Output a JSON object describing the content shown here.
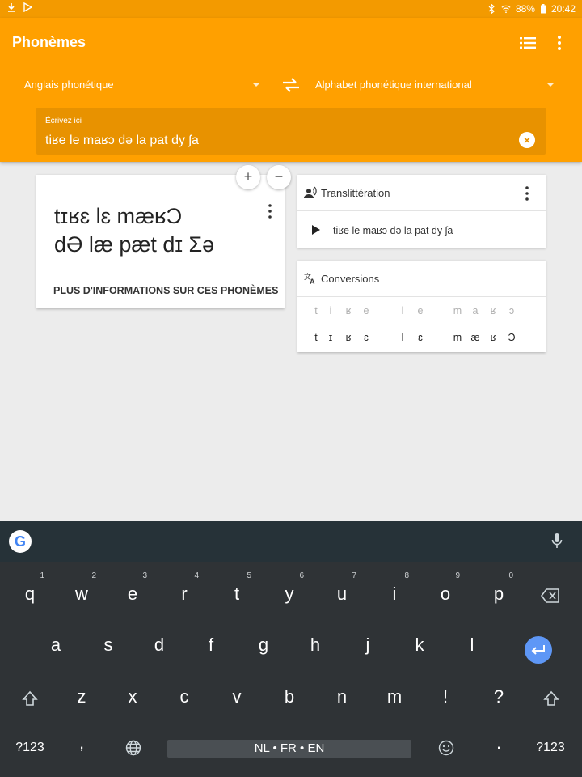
{
  "status": {
    "battery": "88%",
    "time": "20:42"
  },
  "app": {
    "title": "Phonèmes"
  },
  "langs": {
    "source": "Anglais phonétique",
    "target": "Alphabet phonétique international"
  },
  "input": {
    "hint": "Écrivez ici",
    "value": "tiʁe le maʁɔ də la pat dy ʃa"
  },
  "phoneme_card": {
    "line1": "tɪʁɛ lɛ mæʁƆ",
    "line2": "dƏ læ pæt dɪ Σə",
    "link": "PLUS D'INFORMATIONS SUR CES PHONÈMES"
  },
  "zoom": {
    "plus": "+",
    "minus": "−"
  },
  "translit_card": {
    "title": "Translittération",
    "text": "tiʁe le maʁɔ də la pat dy ʃa"
  },
  "conv_card": {
    "title": "Conversions",
    "source": [
      "t",
      "i",
      "ʁ",
      "e",
      "l",
      "e",
      "m",
      "a",
      "ʁ",
      "ɔ"
    ],
    "target": [
      "t",
      "ɪ",
      "ʁ",
      "ɛ",
      "l",
      "ɛ",
      "m",
      "æ",
      "ʁ",
      "Ɔ"
    ]
  },
  "keyboard": {
    "row1": [
      {
        "k": "q",
        "n": "1"
      },
      {
        "k": "w",
        "n": "2"
      },
      {
        "k": "e",
        "n": "3"
      },
      {
        "k": "r",
        "n": "4"
      },
      {
        "k": "t",
        "n": "5"
      },
      {
        "k": "y",
        "n": "6"
      },
      {
        "k": "u",
        "n": "7"
      },
      {
        "k": "i",
        "n": "8"
      },
      {
        "k": "o",
        "n": "9"
      },
      {
        "k": "p",
        "n": "0"
      }
    ],
    "row2": [
      "a",
      "s",
      "d",
      "f",
      "g",
      "h",
      "j",
      "k",
      "l"
    ],
    "row3": [
      "z",
      "x",
      "c",
      "v",
      "b",
      "n",
      "m",
      "!",
      "?"
    ],
    "symbols_left": "?123",
    "comma": ",",
    "space_label": "NL • FR • EN",
    "period": ".",
    "symbols_right": "?123"
  },
  "colors": {
    "primary": "#ffa000",
    "status": "#f39a00",
    "input_bg": "#e89200",
    "keyboard": "#2f3336",
    "enter": "#5e97f6"
  }
}
